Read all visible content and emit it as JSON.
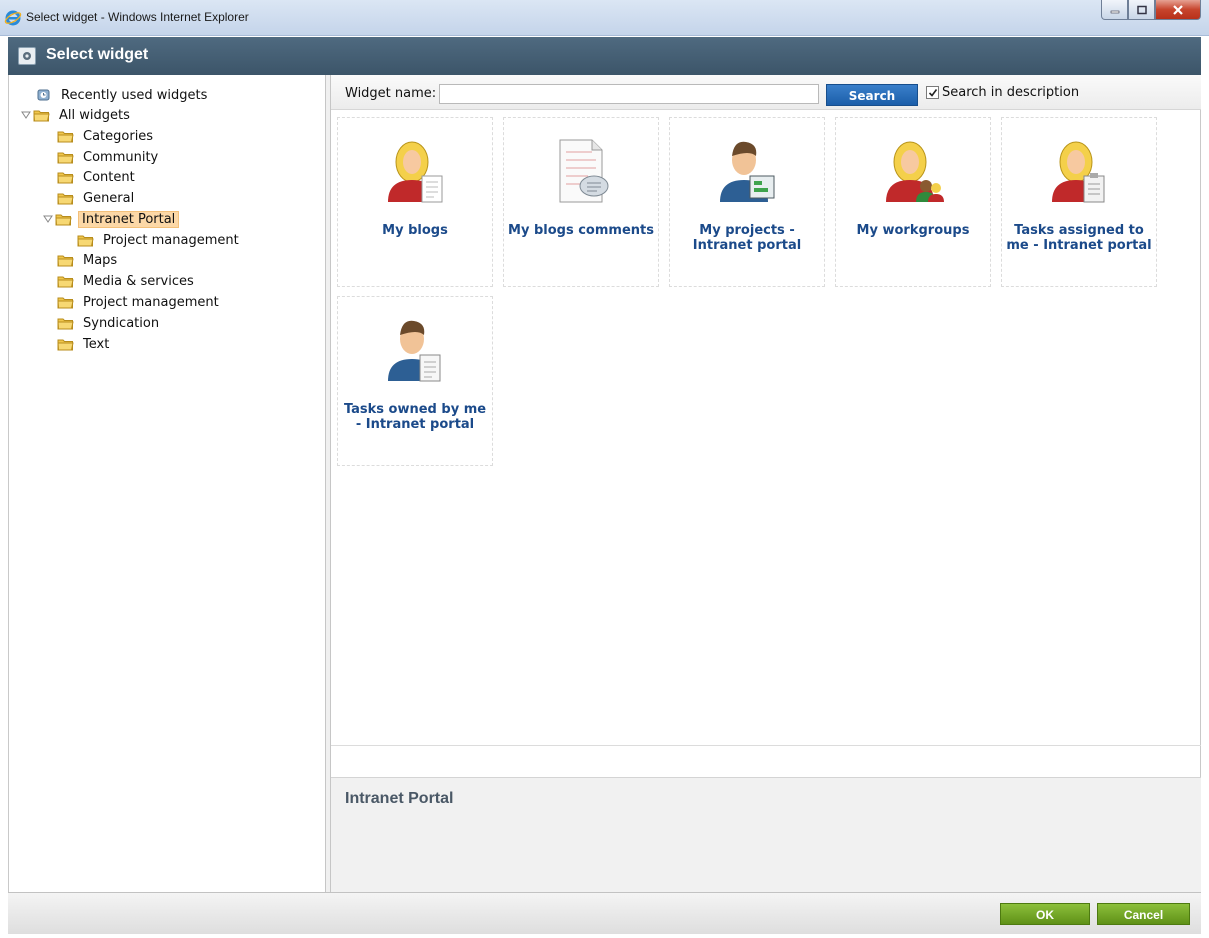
{
  "window": {
    "title": "Select widget - Windows Internet Explorer"
  },
  "dialog": {
    "title": "Select widget"
  },
  "tree": {
    "recently_used": "Recently used widgets",
    "all_widgets": "All widgets",
    "items": [
      {
        "label": "Categories"
      },
      {
        "label": "Community"
      },
      {
        "label": "Content"
      },
      {
        "label": "General"
      },
      {
        "label": "Intranet Portal",
        "selected": true
      },
      {
        "label": "Project management"
      },
      {
        "label": "Maps"
      },
      {
        "label": "Media & services"
      },
      {
        "label": "Project management"
      },
      {
        "label": "Syndication"
      },
      {
        "label": "Text"
      }
    ]
  },
  "search": {
    "label": "Widget name:",
    "value": "",
    "button": "Search",
    "checkbox_label": "Search in description",
    "checkbox_checked": true
  },
  "widgets": [
    {
      "name": "My blogs",
      "icon": "woman-document-icon"
    },
    {
      "name": "My blogs comments",
      "icon": "blog-comments-icon"
    },
    {
      "name": "My projects - Intranet portal",
      "icon": "man-projects-icon"
    },
    {
      "name": "My workgroups",
      "icon": "woman-group-icon"
    },
    {
      "name": "Tasks assigned to me - Intranet portal",
      "icon": "woman-tasks-icon"
    },
    {
      "name": "Tasks owned by me - Intranet portal",
      "icon": "man-tasks-icon"
    }
  ],
  "description": {
    "title": "Intranet Portal"
  },
  "footer": {
    "ok": "OK",
    "cancel": "Cancel"
  },
  "colors": {
    "header": "#3f5a6e",
    "link": "#1b4a8a",
    "search_button": "#1b5ea9",
    "footer_button": "#6a9d1f",
    "selected": "#fcd8a7"
  }
}
